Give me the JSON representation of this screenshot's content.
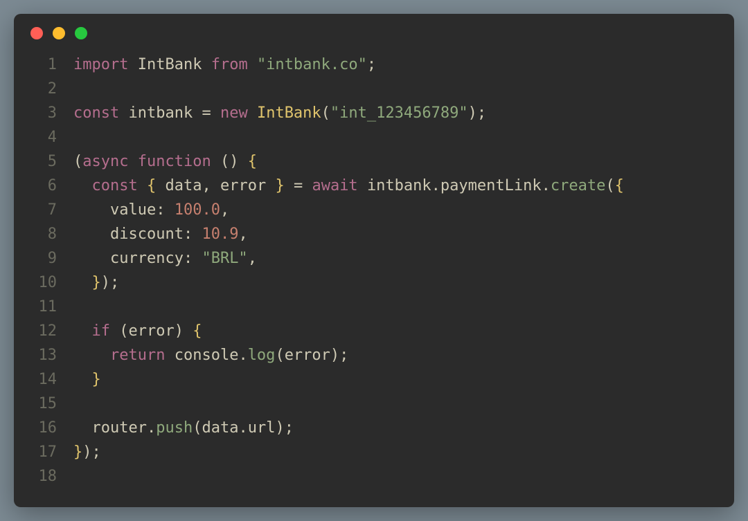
{
  "window": {
    "traffic_lights": [
      "close",
      "minimize",
      "zoom"
    ]
  },
  "code": {
    "line_numbers": [
      "1",
      "2",
      "3",
      "4",
      "5",
      "6",
      "7",
      "8",
      "9",
      "10",
      "11",
      "12",
      "13",
      "14",
      "15",
      "16",
      "17",
      "18"
    ],
    "tokens": {
      "l1": {
        "import": "import",
        "sp": " ",
        "IntBank": "IntBank",
        "from": "from",
        "str": "\"intbank.co\"",
        "semi": ";"
      },
      "l3": {
        "const": "const",
        "intbank": "intbank",
        "eq": "=",
        "new": "new",
        "IntBank": "IntBank",
        "lp": "(",
        "str": "\"int_123456789\"",
        "rp": ")",
        "semi": ";"
      },
      "l5": {
        "lp": "(",
        "async": "async",
        "function": "function",
        "sp": " ",
        "lp2": "(",
        "rp2": ")",
        "lb": "{"
      },
      "l6": {
        "indent": "  ",
        "const": "const",
        "lb": "{",
        "data": "data",
        "comma": ",",
        "error": "error",
        "rb": "}",
        "eq": "=",
        "await": "await",
        "intbank": "intbank",
        "dot": ".",
        "paymentLink": "paymentLink",
        "dot2": ".",
        "create": "create",
        "lp": "(",
        "lb2": "{"
      },
      "l7": {
        "indent": "    ",
        "value": "value",
        "colon": ":",
        "num": "100.0",
        "comma": ","
      },
      "l8": {
        "indent": "    ",
        "discount": "discount",
        "colon": ":",
        "num": "10.9",
        "comma": ","
      },
      "l9": {
        "indent": "    ",
        "currency": "currency",
        "colon": ":",
        "str": "\"BRL\"",
        "comma": ","
      },
      "l10": {
        "indent": "  ",
        "rb": "}",
        "rp": ")",
        "semi": ";"
      },
      "l12": {
        "indent": "  ",
        "if": "if",
        "lp": "(",
        "error": "error",
        "rp": ")",
        "lb": "{"
      },
      "l13": {
        "indent": "    ",
        "return": "return",
        "console": "console",
        "dot": ".",
        "log": "log",
        "lp": "(",
        "error": "error",
        "rp": ")",
        "semi": ";"
      },
      "l14": {
        "indent": "  ",
        "rb": "}"
      },
      "l16": {
        "indent": "  ",
        "router": "router",
        "dot": ".",
        "push": "push",
        "lp": "(",
        "data": "data",
        "dot2": ".",
        "url": "url",
        "rp": ")",
        "semi": ";"
      },
      "l17": {
        "rb": "}",
        "rp": ")",
        "semi": ";"
      }
    }
  }
}
